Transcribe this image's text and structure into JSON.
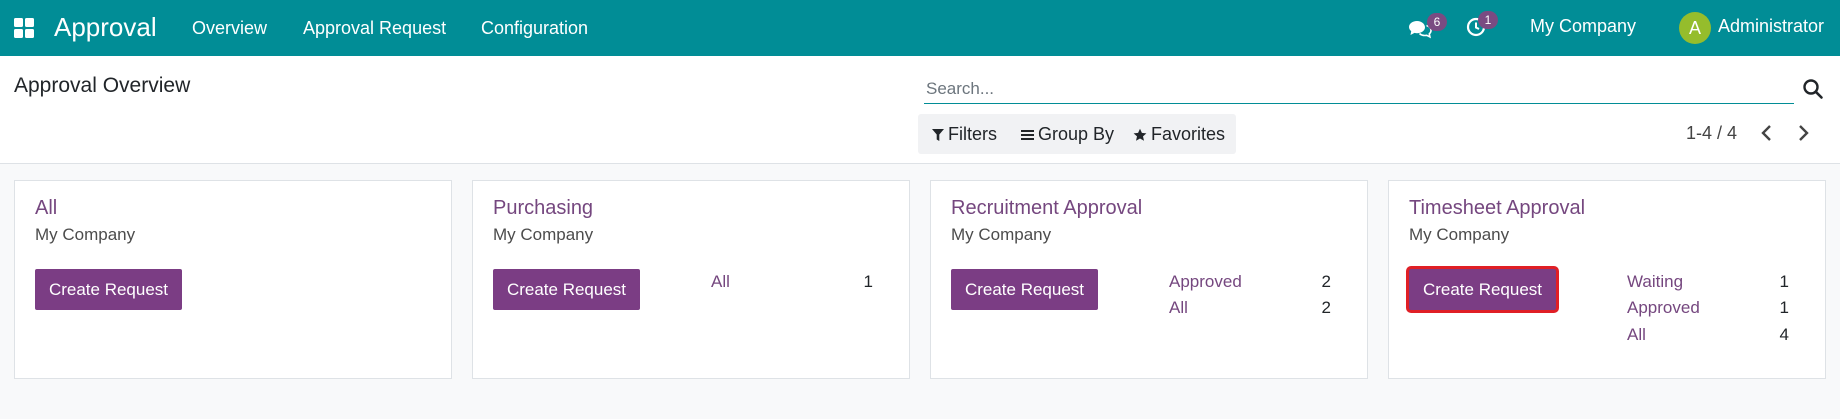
{
  "navbar": {
    "app_title": "Approval",
    "menu": [
      "Overview",
      "Approval Request",
      "Configuration"
    ],
    "messages_badge": "6",
    "activities_badge": "1",
    "company": "My Company",
    "avatar_initial": "A",
    "user": "Administrator",
    "bg_color": "#018d96"
  },
  "control_panel": {
    "title": "Approval Overview",
    "search_placeholder": "Search...",
    "filters_label": "Filters",
    "group_by_label": "Group By",
    "favorites_label": "Favorites",
    "pager": "1-4 / 4"
  },
  "cards": [
    {
      "title": "All",
      "company": "My Company",
      "button": "Create Request",
      "stats": []
    },
    {
      "title": "Purchasing",
      "company": "My Company",
      "button": "Create Request",
      "stats": [
        {
          "label": "All",
          "count": "1"
        }
      ]
    },
    {
      "title": "Recruitment Approval",
      "company": "My Company",
      "button": "Create Request",
      "stats": [
        {
          "label": "Approved",
          "count": "2"
        },
        {
          "label": "All",
          "count": "2"
        }
      ]
    },
    {
      "title": "Timesheet Approval",
      "company": "My Company",
      "button": "Create Request",
      "highlighted": true,
      "stats": [
        {
          "label": "Waiting",
          "count": "1"
        },
        {
          "label": "Approved",
          "count": "1"
        },
        {
          "label": "All",
          "count": "4"
        }
      ]
    }
  ],
  "colors": {
    "accent": "#7b3d84",
    "link": "#75477f",
    "highlight": "#e01f26"
  }
}
